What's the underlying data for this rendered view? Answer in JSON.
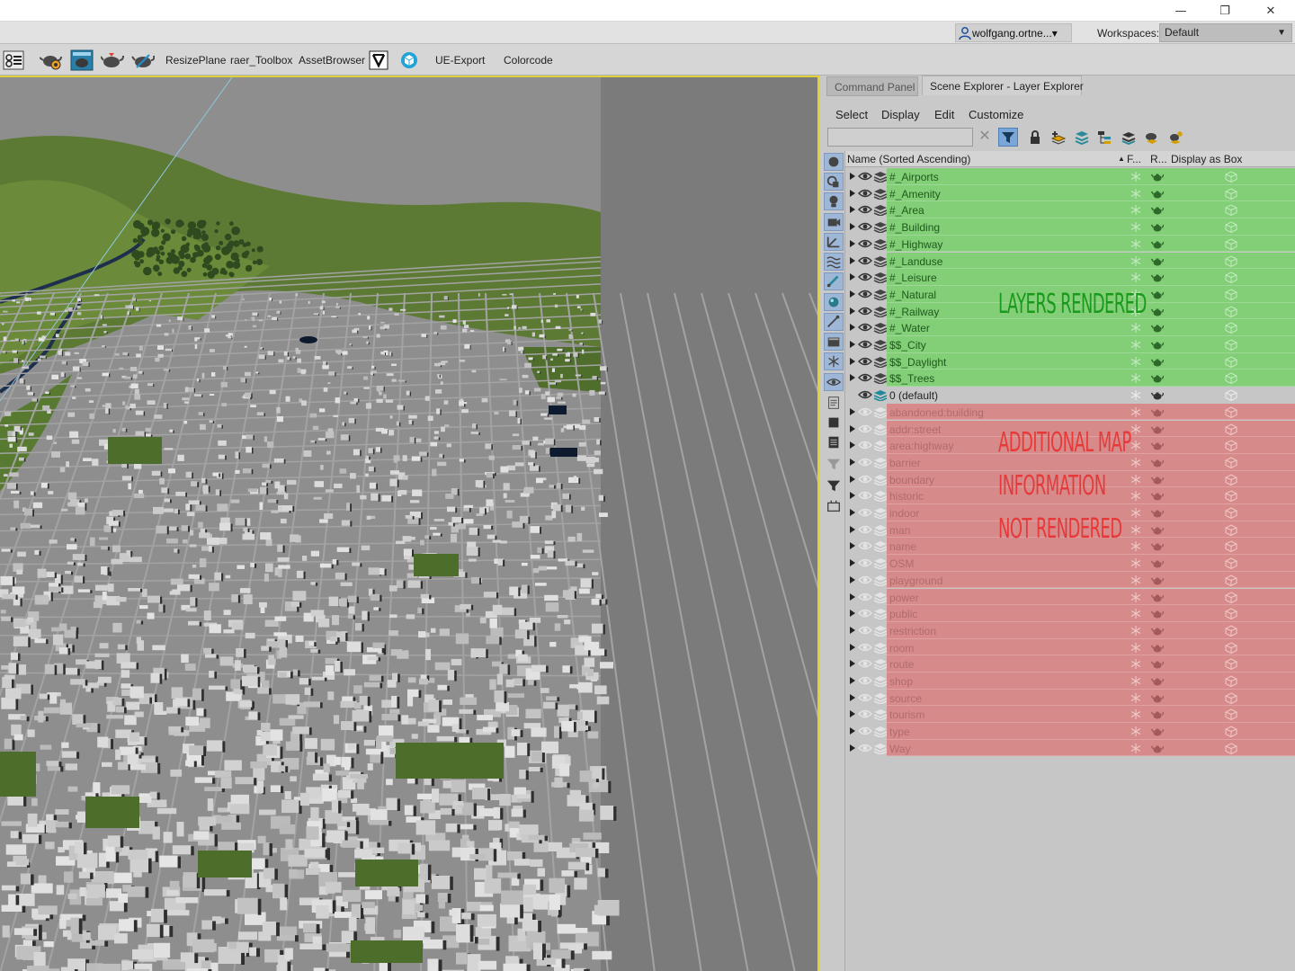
{
  "window": {
    "buttons": {
      "minimize": "—",
      "restore": "❐",
      "close": "✕"
    }
  },
  "account": {
    "user": "wolfgang.ortne...▾",
    "workspaces_label": "Workspaces:",
    "workspace_value": "Default"
  },
  "toolbar": {
    "items": [
      "ResizePlane",
      "raer_Toolbox",
      "AssetBrowser",
      "UE-Export",
      "Colorcode"
    ]
  },
  "panel": {
    "tabs": [
      "Command Panel",
      "Scene Explorer - Layer Explorer"
    ],
    "menu": [
      "Select",
      "Display",
      "Edit",
      "Customize"
    ],
    "search_placeholder": "",
    "columns": {
      "name": "Name (Sorted Ascending)",
      "sort_indicator": "▲",
      "frozen": "F...",
      "render": "R...",
      "display_as_box": "Display as Box"
    },
    "layers_rendered": [
      "#_Airports",
      "#_Amenity",
      "#_Area",
      "#_Building",
      "#_Highway",
      "#_Landuse",
      "#_Leisure",
      "#_Natural",
      "#_Railway",
      "#_Water",
      "$$_City",
      "$$_Daylight",
      "$$_Trees"
    ],
    "default_layer": "0 (default)",
    "layers_not_rendered": [
      "abandoned:building",
      "addr:street",
      "area:highway",
      "barrier",
      "boundary",
      "historic",
      "indoor",
      "man",
      "name",
      "OSM",
      "playground",
      "power",
      "public",
      "restriction",
      "room",
      "route",
      "shop",
      "source",
      "tourism",
      "type",
      "Way"
    ],
    "annotations": {
      "rendered": "LAYERS RENDERED",
      "additional": "ADDITIONAL MAP",
      "information": "INFORMATION",
      "not_rendered": "NOT RENDERED"
    },
    "colors": {
      "rendered_bg": "#82cf78",
      "not_rendered_bg": "#d68a8a",
      "rendered_label": "#1a9a1a",
      "not_rendered_label": "#e63a3a"
    }
  },
  "viewport": {
    "content": "aerial-city-3d-view"
  }
}
